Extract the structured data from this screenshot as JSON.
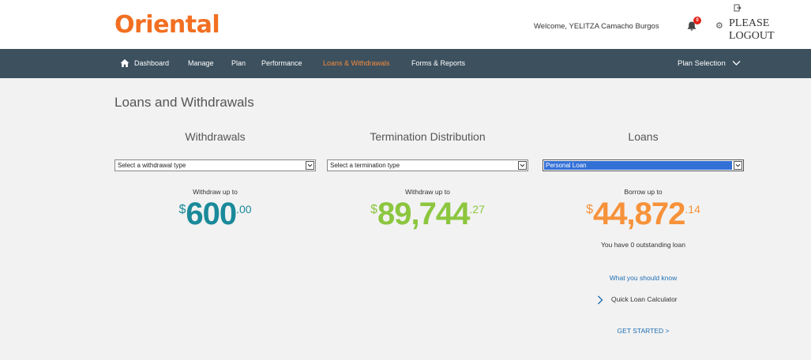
{
  "header": {
    "logo": "Oriental",
    "welcome": "Welcome, YELITZA Camacho Burgos",
    "notification_count": "0",
    "logout_label": "PLEASE LOGOUT"
  },
  "nav": {
    "items": [
      {
        "label": "Dashboard"
      },
      {
        "label": "Manage"
      },
      {
        "label": "Plan"
      },
      {
        "label": "Performance"
      },
      {
        "label": "Loans & Withdrawals"
      },
      {
        "label": "Forms & Reports"
      }
    ],
    "plan_selection": "Plan Selection"
  },
  "page": {
    "title": "Loans and Withdrawals"
  },
  "withdrawals": {
    "heading": "Withdrawals",
    "select_value": "Select a withdrawal type",
    "amount_label": "Withdraw up to",
    "currency": "$",
    "amount_whole": "600",
    "amount_cents": ".00"
  },
  "termination": {
    "heading": "Termination Distribution",
    "select_value": "Select a termination type",
    "amount_label": "Withdraw up to",
    "currency": "$",
    "amount_whole": "89,744",
    "amount_cents": ".27"
  },
  "loans": {
    "heading": "Loans",
    "select_value": "Personal Loan",
    "amount_label": "Borrow up to",
    "currency": "$",
    "amount_whole": "44,872",
    "amount_cents": ".14",
    "outstanding_note": "You have 0 outstanding loan",
    "know_link": "What you should know",
    "calculator_label": "Quick Loan Calculator",
    "get_started": "GET STARTED >"
  },
  "colors": {
    "brand_orange": "#f26f21",
    "nav_bg": "#3c505e",
    "nav_active": "#f58a3c",
    "withdrawals_amount": "#1a8a9a",
    "termination_amount": "#8cc63f",
    "loans_amount": "#f7923a",
    "link_blue": "#1f6fb2"
  },
  "icons": {
    "home": "home-icon",
    "bell": "bell-icon",
    "gear": "gear-icon",
    "logout": "logout-icon",
    "chevron_down": "chevron-down-icon",
    "chevron_right": "chevron-right-icon"
  }
}
